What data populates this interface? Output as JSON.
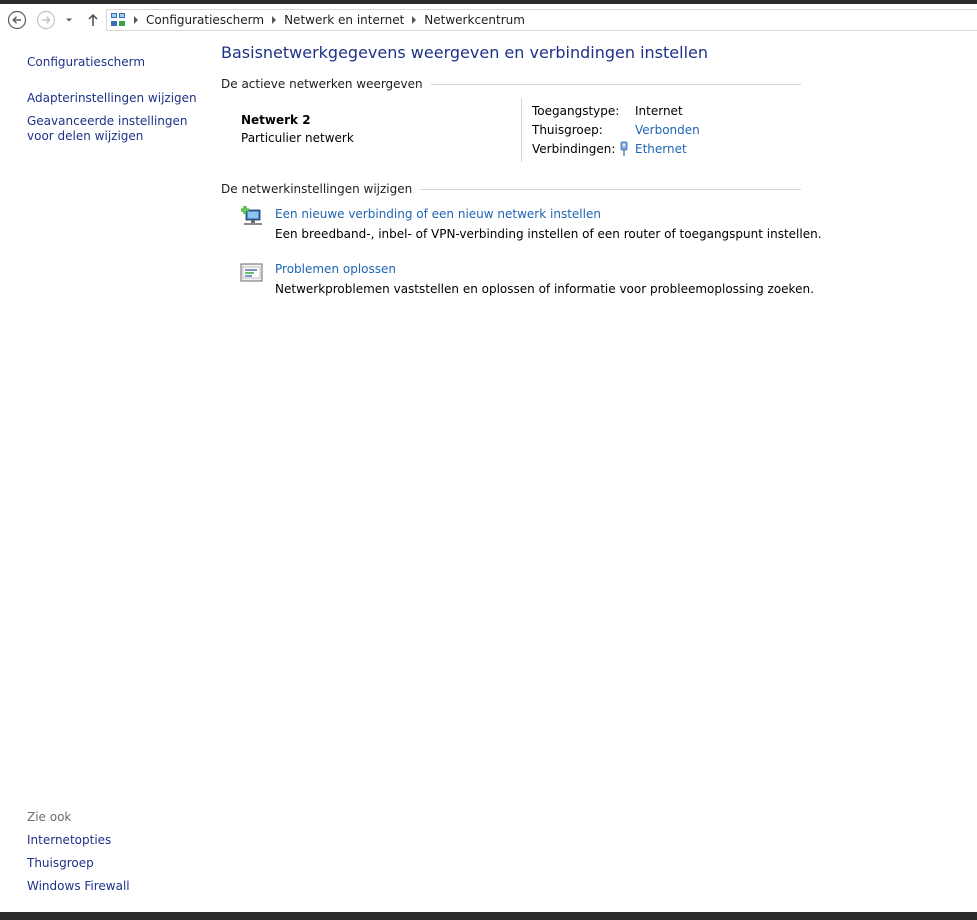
{
  "navigation": {
    "back_icon": "back-arrow-icon",
    "forward_icon": "forward-arrow-icon",
    "recent_icon": "chevron-down-icon",
    "up_icon": "up-arrow-icon"
  },
  "address": {
    "icon": "network-center-icon",
    "crumbs": [
      "Configuratiescherm",
      "Netwerk en internet",
      "Netwerkcentrum"
    ]
  },
  "sidebar": {
    "home_link": "Configuratiescherm",
    "links": [
      "Adapterinstellingen wijzigen",
      "Geavanceerde instellingen voor delen wijzigen"
    ],
    "see_also_heading": "Zie ook",
    "see_also": [
      "Internetopties",
      "Thuisgroep",
      "Windows Firewall"
    ]
  },
  "main": {
    "title": "Basisnetwerkgegevens weergeven en verbindingen instellen",
    "active_networks_heading": "De actieve netwerken weergeven",
    "network": {
      "name": "Netwerk  2",
      "type": "Particulier netwerk",
      "properties": [
        {
          "label": "Toegangstype:",
          "value": "Internet",
          "is_link": false
        },
        {
          "label": "Thuisgroep:",
          "value": "Verbonden",
          "is_link": true
        },
        {
          "label": "Verbindingen:",
          "value": "Ethernet",
          "is_link": true,
          "icon": "ethernet-icon"
        }
      ]
    },
    "change_settings_heading": "De netwerkinstellingen wijzigen",
    "tasks": [
      {
        "icon": "new-connection-icon",
        "link": "Een nieuwe verbinding of een nieuw netwerk instellen",
        "description": "Een breedband-, inbel- of VPN-verbinding instellen of een router of toegangspunt instellen."
      },
      {
        "icon": "troubleshoot-icon",
        "link": "Problemen oplossen",
        "description": "Netwerkproblemen vaststellen en oplossen of informatie voor probleemoplossing zoeken."
      }
    ]
  },
  "colors": {
    "link": "#1e64b4",
    "nav_link": "#1e3287",
    "title": "#1e3287",
    "muted": "#6d6d6d",
    "rule": "#d5d5d5"
  }
}
